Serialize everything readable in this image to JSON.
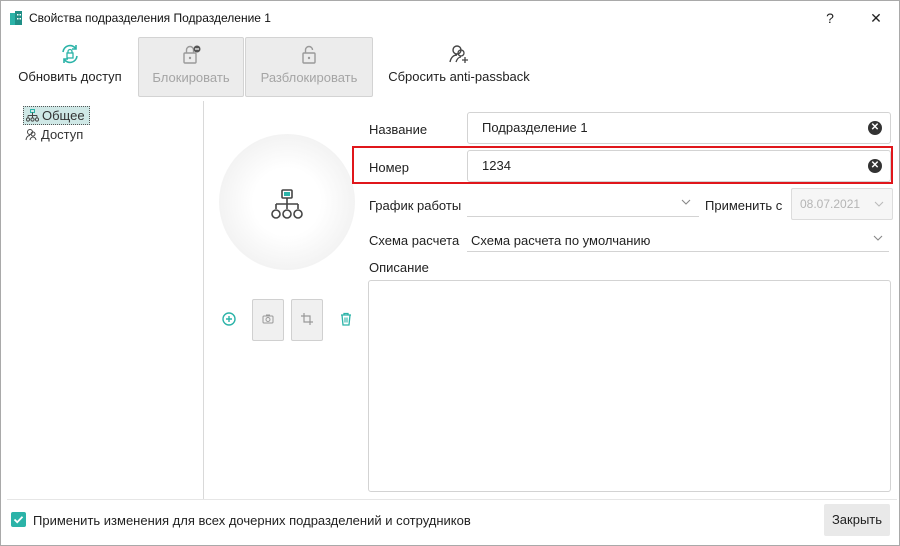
{
  "window": {
    "title": "Свойства подразделения Подразделение 1",
    "help_label": "?",
    "close_label": "✕"
  },
  "toolbar": {
    "refresh_label": "Обновить доступ",
    "block_label": "Блокировать",
    "unblock_label": "Разблокировать",
    "reset_label": "Сбросить anti-passback"
  },
  "tree": {
    "items": [
      {
        "label": "Общее",
        "icon": "org-structure-icon",
        "selected": true
      },
      {
        "label": "Доступ",
        "icon": "users-icon",
        "selected": false
      }
    ]
  },
  "form": {
    "name_label": "Название",
    "name_value": "Подразделение 1",
    "number_label": "Номер",
    "number_value": "1234",
    "schedule_label": "График работы",
    "schedule_value": "",
    "apply_from_label": "Применить с",
    "apply_from_value": "08.07.2021",
    "calc_label": "Схема расчета",
    "calc_value": "Схема расчета по умолчанию",
    "description_label": "Описание",
    "description_value": ""
  },
  "footer": {
    "apply_children_label": "Применить изменения для всех дочерних подразделений и сотрудников",
    "apply_children_checked": true,
    "close_button_label": "Закрыть"
  },
  "colors": {
    "accent": "#2bb3a8",
    "highlight": "#e0161b"
  }
}
